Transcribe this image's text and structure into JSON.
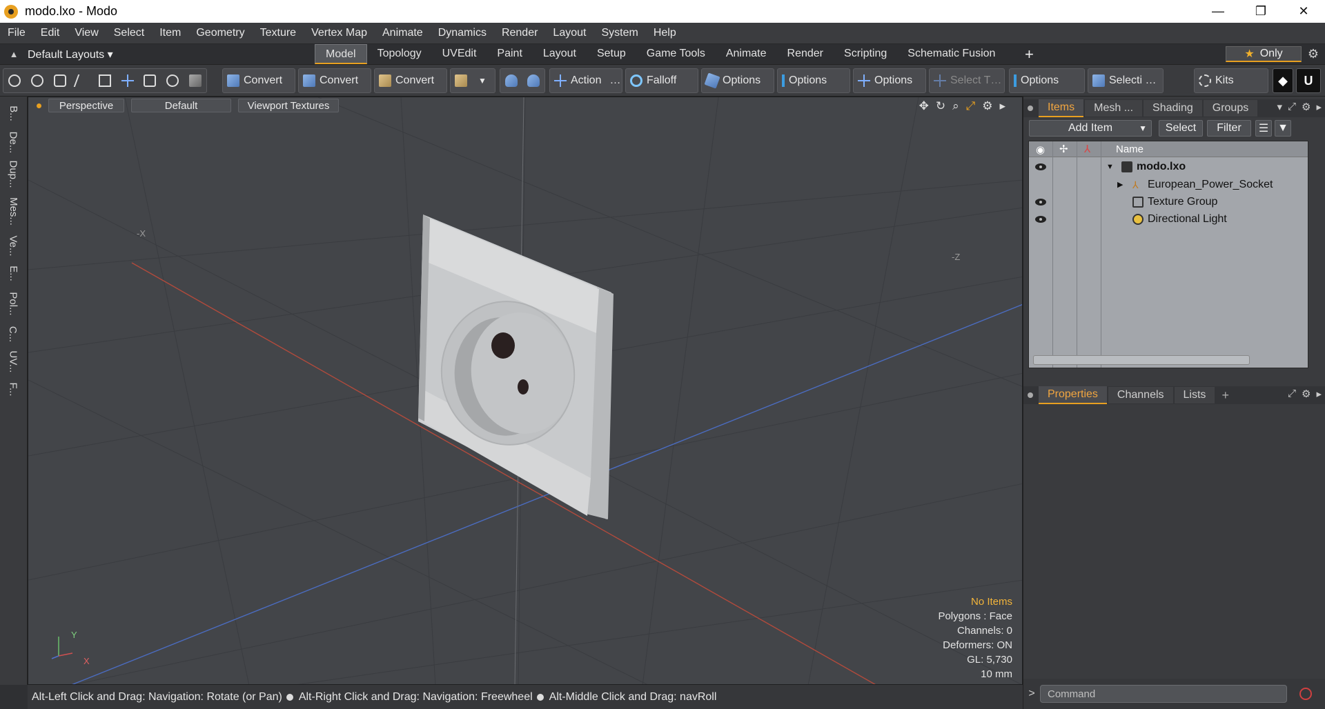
{
  "window": {
    "title": "modo.lxo - Modo",
    "minimize": "—",
    "restore": "❐",
    "close": "✕"
  },
  "menu": [
    "File",
    "Edit",
    "View",
    "Select",
    "Item",
    "Geometry",
    "Texture",
    "Vertex Map",
    "Animate",
    "Dynamics",
    "Render",
    "Layout",
    "System",
    "Help"
  ],
  "layout_selector": {
    "label": "Default Layouts ▾"
  },
  "mode_tabs": [
    "Model",
    "Topology",
    "UVEdit",
    "Paint",
    "Layout",
    "Setup",
    "Game Tools",
    "Animate",
    "Render",
    "Scripting",
    "Schematic Fusion"
  ],
  "active_tab": "Model",
  "only_button": {
    "star": "★",
    "label": "Only"
  },
  "toolbar": {
    "convert1": "Convert",
    "convert2": "Convert",
    "convert3": "Convert",
    "action": "Action",
    "action_more": "…",
    "falloff": "Falloff",
    "options1": "Options",
    "options2": "Options",
    "options3": "Options",
    "select_t": "Select T…",
    "options4": "Options",
    "selecti": "Selecti …",
    "kits": "Kits"
  },
  "left_tool_tabs": [
    "B...",
    "De...",
    "Dup...",
    "Mes...",
    "Ve...",
    "E...",
    "Pol...",
    "C...",
    "UV...",
    "F..."
  ],
  "viewport": {
    "view": "Perspective",
    "shading": "Default",
    "textures": "Viewport Textures",
    "axis_neg_x": "-X",
    "axis_neg_z": "-Z",
    "gizmo_y": "Y",
    "gizmo_x": "X",
    "info": {
      "selection": "No Items",
      "polygons": "Polygons : Face",
      "channels": "Channels: 0",
      "deformers": "Deformers: ON",
      "gl": "GL: 5,730",
      "grid": "10 mm"
    }
  },
  "status": {
    "hint1": "Alt-Left Click and Drag: Navigation: Rotate (or Pan)",
    "hint2": "Alt-Right Click and Drag: Navigation: Freewheel",
    "hint3": "Alt-Middle Click and Drag: navRoll"
  },
  "items_panel": {
    "tabs": [
      "Items",
      "Mesh ...",
      "Shading",
      "Groups"
    ],
    "add_item": "Add Item",
    "select": "Select",
    "filter": "Filter",
    "column_name": "Name",
    "tree": [
      {
        "label": "modo.lxo",
        "visible": true
      },
      {
        "label": "European_Power_Socket",
        "visible": false
      },
      {
        "label": "Texture Group",
        "visible": true
      },
      {
        "label": "Directional Light",
        "visible": true
      }
    ]
  },
  "properties_panel": {
    "tabs": [
      "Properties",
      "Channels",
      "Lists"
    ],
    "add": "+"
  },
  "command": {
    "placeholder": "Command",
    "prompt": ">"
  }
}
